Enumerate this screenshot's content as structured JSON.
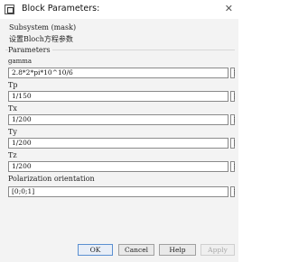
{
  "window": {
    "title": "Block Parameters:",
    "close_glyph": "✕",
    "icon": "block-icon"
  },
  "header": {
    "subsystem": "Subsystem (mask)",
    "description": "设置Bloch方程参数"
  },
  "parameters": {
    "label": "Parameters",
    "fields": [
      {
        "label": "gamma",
        "value": "2.8*2*pi*10^10/6"
      },
      {
        "label": "Tp",
        "value": "1/150"
      },
      {
        "label": "Tx",
        "value": "1/200"
      },
      {
        "label": "Ty",
        "value": "1/200"
      },
      {
        "label": "Tz",
        "value": "1/200"
      },
      {
        "label": "Polarization orientation",
        "value": "[0;0;1]"
      }
    ],
    "more_glyph": "⋮"
  },
  "buttons": {
    "ok": "OK",
    "cancel": "Cancel",
    "help": "Help",
    "apply": "Apply"
  }
}
